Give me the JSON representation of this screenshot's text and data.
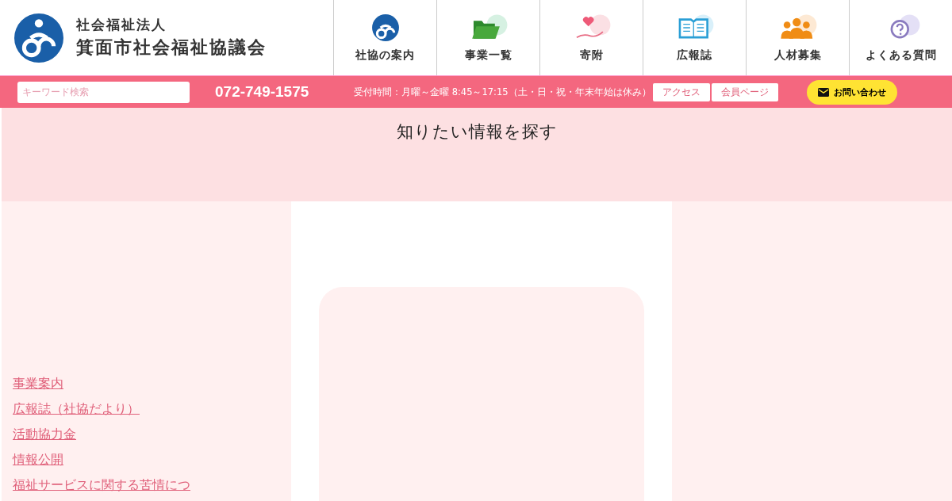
{
  "logo": {
    "subtitle": "社会福祉法人",
    "title": "箕面市社会福祉協議会"
  },
  "nav": [
    {
      "label": "社協の案内"
    },
    {
      "label": "事業一覧"
    },
    {
      "label": "寄附"
    },
    {
      "label": "広報誌"
    },
    {
      "label": "人材募集"
    },
    {
      "label": "よくある質問"
    }
  ],
  "search": {
    "placeholder": "キーワード検索"
  },
  "phone": "072-749-1575",
  "hours": "受付時間：月曜～金曜 8:45～17:15（土・日・祝・年末年始は休み）",
  "links": [
    "アクセス",
    "会員ページ"
  ],
  "contact_button": "お問い合わせ",
  "section_title": "知りたい情報を探す",
  "side_links": [
    "事業案内",
    "広報誌（社協だより）",
    "活動協力金",
    "情報公開",
    "福祉サービスに関する苦情につ"
  ]
}
